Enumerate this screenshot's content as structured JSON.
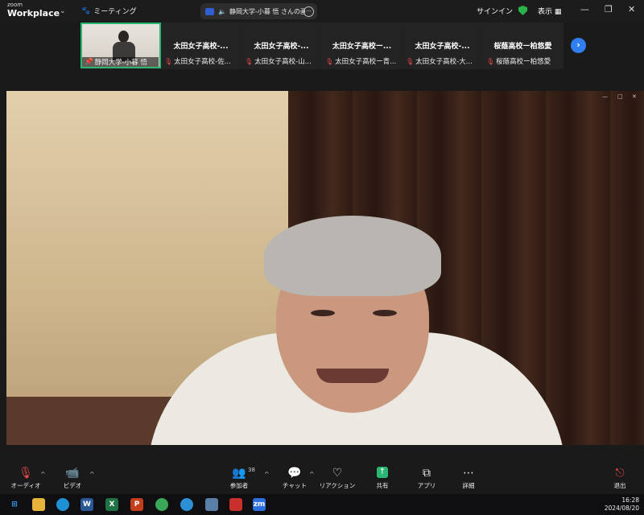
{
  "topbar": {
    "logo_small": "zoom",
    "logo_big": "Workplace",
    "meeting_menu_label": "ミーティング",
    "meeting_title": "静岡大学-小暮 悟 さんの画面",
    "signin_label": "サインイン",
    "view_label": "表示",
    "accent_color": "#2bb673"
  },
  "strip": {
    "active_tile_label": "静岡大学-小暮 悟",
    "tiles": [
      {
        "name": "太田女子高校-...",
        "sub": "太田女子高校-佐..."
      },
      {
        "name": "太田女子高校-...",
        "sub": "太田女子高校-山..."
      },
      {
        "name": "太田女子高校ー...",
        "sub": "太田女子高校ー青..."
      },
      {
        "name": "太田女子高校-...",
        "sub": "太田女子高校-大..."
      },
      {
        "name": "桜蔭高校ー柏悠愛",
        "sub": "桜蔭高校ー柏悠愛"
      }
    ]
  },
  "toolbar": {
    "audio_label": "オーディオ",
    "video_label": "ビデオ",
    "participants_label": "参加者",
    "participants_count": "38",
    "chat_label": "チャット",
    "reactions_label": "リアクション",
    "share_label": "共有",
    "apps_label": "アプリ",
    "more_label": "詳細",
    "leave_label": "退出"
  },
  "taskbar": {
    "time": "16:28",
    "date": "2024/08/20",
    "zoom_icon_text": "zm"
  }
}
